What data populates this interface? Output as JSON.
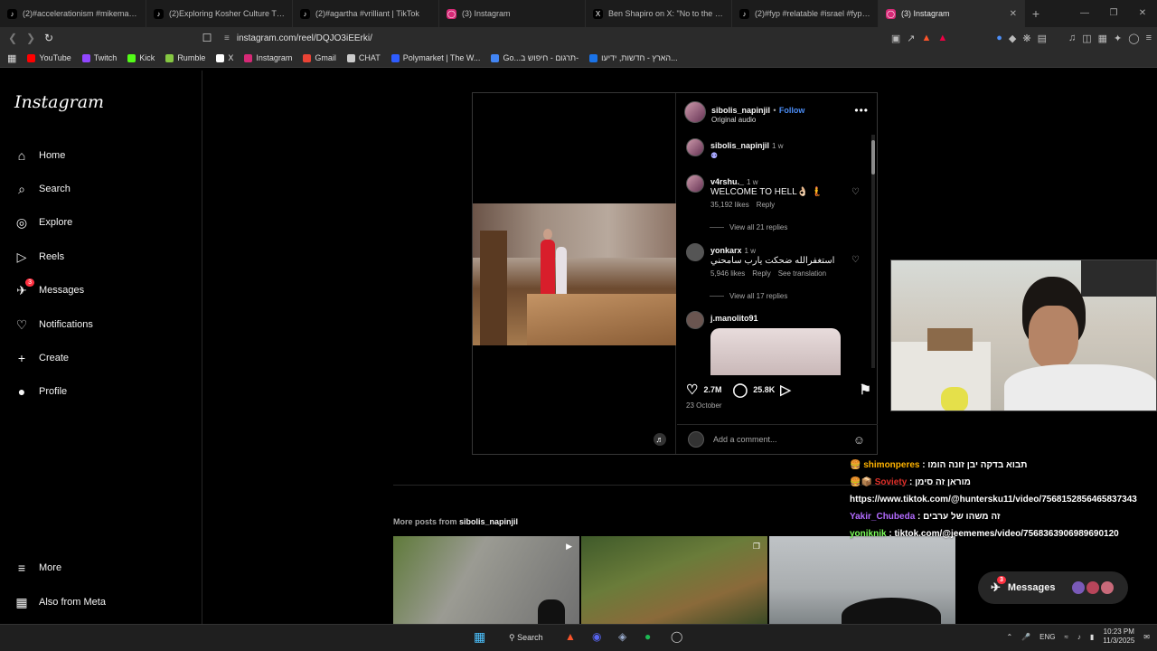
{
  "tabs": [
    {
      "title": "(2)#accelerationism #mikema | acce",
      "icon": "tiktok-icon",
      "color": "#000000"
    },
    {
      "title": "(2)Exploring Kosher Culture Through",
      "icon": "tiktok-icon",
      "color": "#000000"
    },
    {
      "title": "(2)#agartha #vrilliant | TikTok",
      "icon": "tiktok-icon",
      "color": "#000000"
    },
    {
      "title": "(3) Instagram",
      "icon": "instagram-icon",
      "color": "#d62976"
    },
    {
      "title": "Ben Shapiro on X: \"No to the groype",
      "icon": "x-icon",
      "color": "#000000"
    },
    {
      "title": "(2)#fyp #relatable #israel #fypד | Ge",
      "icon": "tiktok-icon",
      "color": "#000000"
    },
    {
      "title": "(3) Instagram",
      "icon": "instagram-icon",
      "color": "#d62976",
      "active": true
    }
  ],
  "address": {
    "url": "instagram.com/reel/DQJO3iEErki/"
  },
  "bookmarks": [
    {
      "label": "YouTube",
      "color": "#ff0000"
    },
    {
      "label": "Twitch",
      "color": "#9146ff"
    },
    {
      "label": "Kick",
      "color": "#53fc18"
    },
    {
      "label": "Rumble",
      "color": "#85c742"
    },
    {
      "label": "X",
      "color": "#ffffff"
    },
    {
      "label": "Instagram",
      "color": "#d62976"
    },
    {
      "label": "Gmail",
      "color": "#ea4335"
    },
    {
      "label": "CHAT",
      "color": "#cccccc"
    },
    {
      "label": "Polymarket | The W...",
      "color": "#2e5cff"
    },
    {
      "label": "Go...תרגום - חיפוש ב-",
      "color": "#4285f4"
    },
    {
      "label": "הארץ - חדשות, ידיעו...",
      "color": "#1a73e8"
    }
  ],
  "sidebar": {
    "logo": "Instagram",
    "items": [
      {
        "label": "Home",
        "icon": "home-icon",
        "glyph": "⌂"
      },
      {
        "label": "Search",
        "icon": "search-icon",
        "glyph": "⌕"
      },
      {
        "label": "Explore",
        "icon": "explore-icon",
        "glyph": "◎"
      },
      {
        "label": "Reels",
        "icon": "reels-icon",
        "glyph": "▷"
      },
      {
        "label": "Messages",
        "icon": "messages-icon",
        "glyph": "✈",
        "badge": "3"
      },
      {
        "label": "Notifications",
        "icon": "heart-icon",
        "glyph": "♡"
      },
      {
        "label": "Create",
        "icon": "plus-icon",
        "glyph": "+"
      },
      {
        "label": "Profile",
        "icon": "profile-icon",
        "glyph": "●"
      },
      {
        "label": "More",
        "icon": "menu-icon",
        "glyph": "≡"
      },
      {
        "label": "Also from Meta",
        "icon": "meta-icon",
        "glyph": "▦"
      }
    ]
  },
  "post": {
    "author": "sibolis_napinjil",
    "follow": "Follow",
    "separator": "•",
    "audio": "Original audio",
    "caption_author": "sibolis_napinjil",
    "caption_time": "1 w",
    "likes": "2.7M",
    "comments_count": "25.8K",
    "date": "23 October",
    "add_comment_placeholder": "Add a comment..."
  },
  "comments": [
    {
      "user": "v4rshu._",
      "time": "1 w",
      "text": "WELCOME TO HELL👌🏻 🧜",
      "likes": "35,192 likes",
      "reply": "Reply",
      "view_replies": "View all 21 replies"
    },
    {
      "user": "yonkarx",
      "time": "1 w",
      "text": "استغفرالله ضحكت يارب سامحني",
      "likes": "5,946 likes",
      "reply": "Reply",
      "translate": "See translation",
      "view_replies": "View all 17 replies"
    },
    {
      "user": "j.manolito91",
      "time": "",
      "text": ""
    }
  ],
  "more_posts": {
    "prefix": "More posts from ",
    "user": "sibolis_napinjil"
  },
  "chat": [
    {
      "emote": "🍔",
      "user": "shimonperes",
      "color": "#ffb300",
      "msg": ": תבוא בדקה יבן זונה הומו"
    },
    {
      "emote": "🍔📦",
      "user": "Soviety",
      "color": "#e0302a",
      "msg": ": מוראן זה סימן"
    },
    {
      "emote": "",
      "user": "",
      "color": "#ffffff",
      "msg": "https://www.tiktok.com/@huntersku11/video/7568152856465837343"
    },
    {
      "emote": "",
      "user": "Yakir_Chubeda",
      "color": "#b36bff",
      "msg": ": זה משהו של ערבים"
    },
    {
      "emote": "",
      "user": "yoniknik",
      "color": "#7cff5a",
      "msg": ": tiktok.com/@jeememes/video/7568363906989690120"
    }
  ],
  "messages_button": {
    "label": "Messages",
    "badge": "3"
  },
  "taskbar": {
    "search": "Search",
    "lang": "ENG",
    "time": "10:23 PM",
    "date": "11/3/2025"
  }
}
